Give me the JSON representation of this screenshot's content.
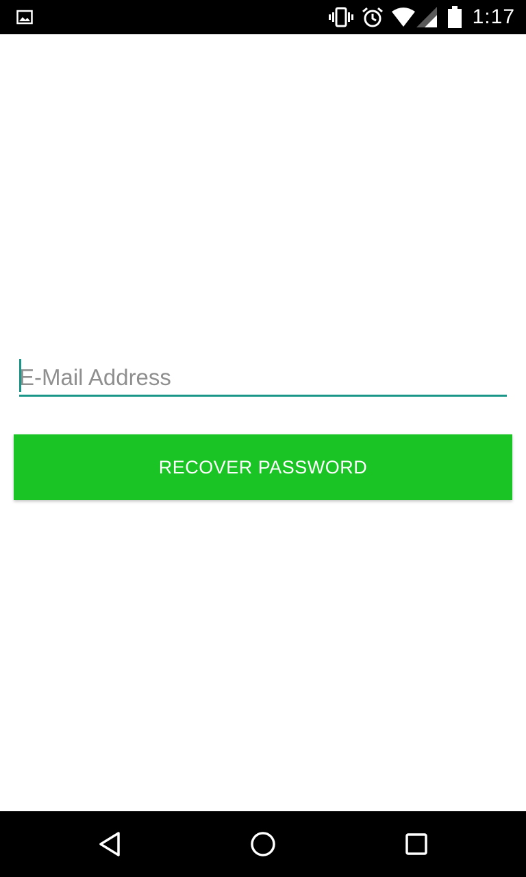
{
  "status_bar": {
    "time": "1:17",
    "icons": [
      "image-icon",
      "vibrate-icon",
      "alarm-icon",
      "wifi-icon",
      "signal-icon",
      "battery-icon"
    ]
  },
  "form": {
    "email_placeholder": "E-Mail Address",
    "email_value": "",
    "recover_label": "RECOVER PASSWORD"
  },
  "nav_bar": {
    "icons": [
      "back-icon",
      "home-icon",
      "recent-apps-icon"
    ]
  },
  "colors": {
    "accent": "#1a9688",
    "button": "#1bc425",
    "bars": "#000000"
  }
}
